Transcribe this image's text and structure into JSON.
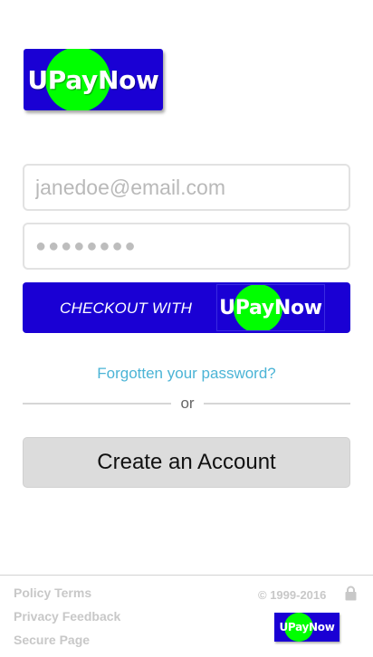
{
  "brand": {
    "name": "UPayNow",
    "colors": {
      "primary": "#1a00d4",
      "accent": "#00ff00",
      "link": "#4bb4d6",
      "secondary_button": "#dcdcdc"
    }
  },
  "login": {
    "email_placeholder": "janedoe@email.com",
    "password_value": "●●●●●●●●"
  },
  "checkout": {
    "label": "CHECKOUT WITH",
    "brand": "UPayNow"
  },
  "forgot_password": "Forgotten your password?",
  "divider": "or",
  "create_account": "Create an Account",
  "footer": {
    "links": [
      "Policy Terms",
      "Privacy Feedback",
      "Secure Page"
    ],
    "copyright": "© 1999-2016",
    "lock_icon": "lock-icon",
    "logo": "UPayNow"
  }
}
